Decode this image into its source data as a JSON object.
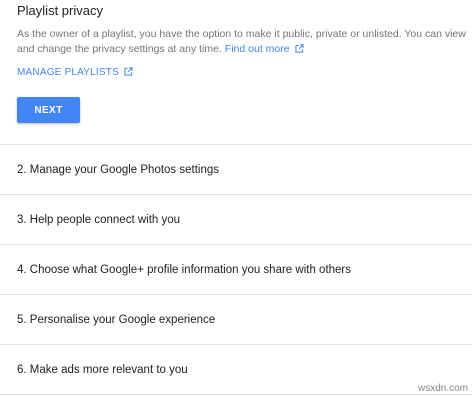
{
  "privacy": {
    "title": "Playlist privacy",
    "description_line1": "As the owner of a playlist, you have the option to make it public, private or unlisted. You can view and change the privacy settings at any time. ",
    "find_out_more": "Find out more",
    "manage_playlists": "MANAGE PLAYLISTS",
    "next_label": "NEXT",
    "icons": {
      "external_link": "open-in-new-icon"
    },
    "colors": {
      "link": "#4285f4",
      "button": "#4285f4"
    }
  },
  "steps": [
    {
      "label": "2. Manage your Google Photos settings"
    },
    {
      "label": "3. Help people connect with you"
    },
    {
      "label": "4. Choose what Google+ profile information you share with others"
    },
    {
      "label": "5. Personalise your Google experience"
    },
    {
      "label": "6. Make ads more relevant to you"
    }
  ],
  "watermark": "wsxdn.com"
}
